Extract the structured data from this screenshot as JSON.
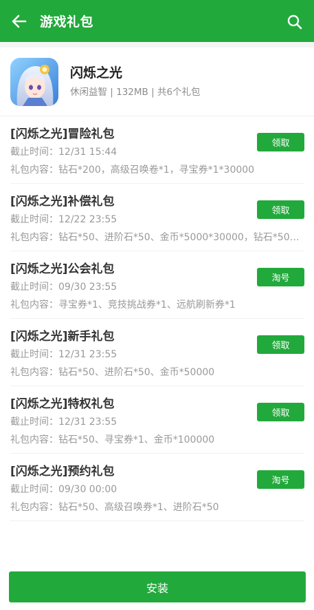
{
  "header": {
    "title": "游戏礼包",
    "back_icon": "arrow-left-icon",
    "search_icon": "search-icon",
    "color": "#22a93c"
  },
  "app": {
    "name": "闪烁之光",
    "meta": "休闲益智 | 132MB | 共6个礼包",
    "icon": "game-app-icon"
  },
  "gifts": [
    {
      "title": "[闪烁之光]冒险礼包",
      "deadline": "截止时间：12/31 15:44",
      "content": "礼包内容：钻石*200，高级召唤卷*1，寻宝券*1*30000",
      "button": "领取"
    },
    {
      "title": "[闪烁之光]补偿礼包",
      "deadline": "截止时间：12/22 23:55",
      "content": "礼包内容：钻石*50、进阶石*50、金币*5000*30000，钻石*50、…",
      "button": "领取"
    },
    {
      "title": "[闪烁之光]公会礼包",
      "deadline": "截止时间：09/30 23:55",
      "content": "礼包内容：寻宝券*1、竞技挑战券*1、远航刷新券*1",
      "button": "淘号"
    },
    {
      "title": "[闪烁之光]新手礼包",
      "deadline": "截止时间：12/31 23:55",
      "content": "礼包内容：钻石*50、进阶石*50、金币*50000",
      "button": "领取"
    },
    {
      "title": "[闪烁之光]特权礼包",
      "deadline": "截止时间：12/31 23:55",
      "content": "礼包内容：钻石*50、寻宝券*1、金币*100000",
      "button": "领取"
    },
    {
      "title": "[闪烁之光]预约礼包",
      "deadline": "截止时间：09/30 00:00",
      "content": "礼包内容：钻石*50、高级召唤券*1、进阶石*50",
      "button": "淘号"
    }
  ],
  "footer": {
    "install_label": "安装"
  }
}
